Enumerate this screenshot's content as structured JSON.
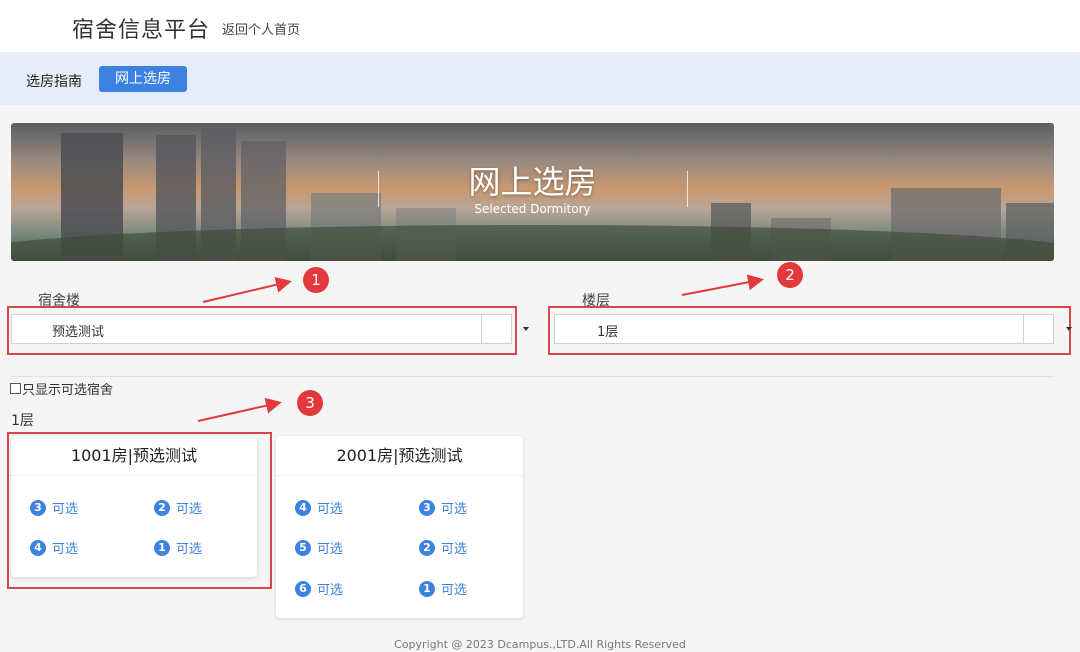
{
  "header": {
    "brand": "宿舍信息平台",
    "home_link": "返回个人首页"
  },
  "nav": {
    "guide": "选房指南",
    "online_select": "网上选房"
  },
  "banner": {
    "title": "网上选房",
    "subtitle": "Selected Dormitory"
  },
  "filters": {
    "building_label": "宿舍楼",
    "building_value": "预选测试",
    "floor_label": "楼层",
    "floor_value": "1层",
    "only_available_label": "只显示可选宿舍"
  },
  "annotations": [
    "1",
    "2",
    "3"
  ],
  "floor_heading": "1层",
  "rooms": [
    {
      "title": "1001房|预选测试",
      "beds": [
        {
          "num": "3",
          "status": "可选"
        },
        {
          "num": "2",
          "status": "可选"
        },
        {
          "num": "4",
          "status": "可选"
        },
        {
          "num": "1",
          "status": "可选"
        }
      ]
    },
    {
      "title": "2001房|预选测试",
      "beds": [
        {
          "num": "4",
          "status": "可选"
        },
        {
          "num": "3",
          "status": "可选"
        },
        {
          "num": "5",
          "status": "可选"
        },
        {
          "num": "2",
          "status": "可选"
        },
        {
          "num": "6",
          "status": "可选"
        },
        {
          "num": "1",
          "status": "可选"
        }
      ]
    }
  ],
  "footer": "Copyright @ 2023 Dcampus.,LTD.All Rights Reserved",
  "colors": {
    "accent": "#3d82e0",
    "annotation_red": "#e4393c",
    "nav_bg": "#e6edf8"
  }
}
